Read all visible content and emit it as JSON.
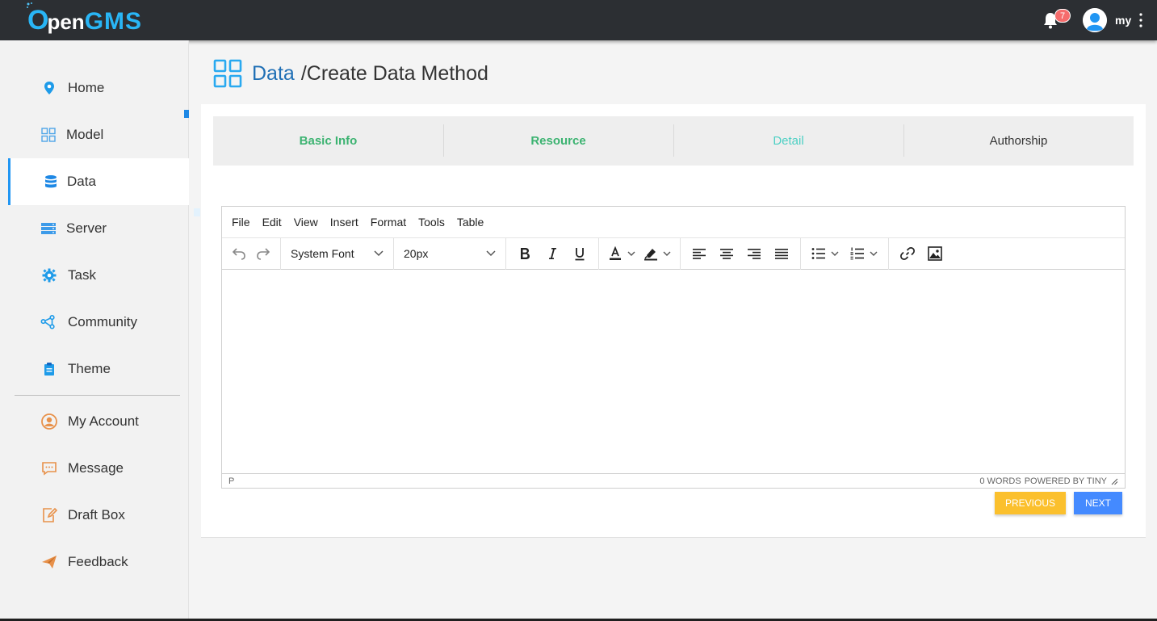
{
  "header": {
    "logo_o": "O",
    "logo_pen": "pen",
    "logo_gms": "GMS",
    "notification_count": "7",
    "username": "my"
  },
  "sidebar": {
    "items": [
      {
        "label": "Home",
        "icon": "location-pin-icon"
      },
      {
        "label": "Model",
        "icon": "grid-icon"
      },
      {
        "label": "Data",
        "icon": "database-icon",
        "active": true
      },
      {
        "label": "Server",
        "icon": "server-icon"
      },
      {
        "label": "Task",
        "icon": "gear-icon"
      },
      {
        "label": "Community",
        "icon": "share-nodes-icon"
      },
      {
        "label": "Theme",
        "icon": "clipboard-icon"
      }
    ],
    "account_items": [
      {
        "label": "My Account",
        "icon": "user-circle-icon"
      },
      {
        "label": "Message",
        "icon": "message-icon"
      },
      {
        "label": "Draft Box",
        "icon": "draft-icon"
      },
      {
        "label": "Feedback",
        "icon": "paper-plane-icon"
      }
    ]
  },
  "page": {
    "crumb_data": "Data",
    "crumb_rest": "/Create Data Method"
  },
  "steps": [
    {
      "label": "Basic Info",
      "state": "done"
    },
    {
      "label": "Resource",
      "state": "done"
    },
    {
      "label": "Detail",
      "state": "current"
    },
    {
      "label": "Authorship",
      "state": "todo"
    }
  ],
  "editor": {
    "menu": [
      "File",
      "Edit",
      "View",
      "Insert",
      "Format",
      "Tools",
      "Table"
    ],
    "font_family": "System Font",
    "font_size": "20px",
    "status_path": "P",
    "word_count": "0 WORDS",
    "powered_by": "POWERED BY TINY"
  },
  "buttons": {
    "previous": "PREVIOUS",
    "next": "NEXT"
  },
  "colors": {
    "accent": "#29b6f6",
    "step_done": "#3cb371",
    "step_current": "#4dd0c4",
    "previous_button": "#fbc02d",
    "next_button": "#448aff"
  }
}
